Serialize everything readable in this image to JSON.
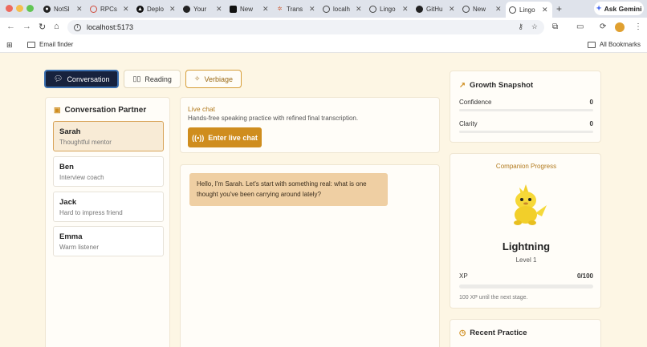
{
  "browser": {
    "tabs": [
      {
        "label": "NotSl",
        "icon": "github-icon"
      },
      {
        "label": "RPCs",
        "icon": "rpc-icon"
      },
      {
        "label": "Deplo",
        "icon": "vercel-icon"
      },
      {
        "label": "Your",
        "icon": "github-icon"
      },
      {
        "label": "New",
        "icon": "notion-icon"
      },
      {
        "label": "Trans",
        "icon": "transcription-icon"
      },
      {
        "label": "localh",
        "icon": "globe-icon"
      },
      {
        "label": "Lingo",
        "icon": "globe-icon"
      },
      {
        "label": "GitHu",
        "icon": "github-icon"
      },
      {
        "label": "New",
        "icon": "globe-icon"
      },
      {
        "label": "Lingo",
        "icon": "globe-icon",
        "active": true
      }
    ],
    "gemini_label": "Ask Gemini",
    "url": "localhost:5173",
    "bookmarks": {
      "item": "Email finder",
      "all": "All Bookmarks"
    }
  },
  "modes": {
    "conversation": "Conversation",
    "reading": "Reading",
    "verbiage": "Verbiage"
  },
  "partners": {
    "title": "Conversation Partner",
    "items": [
      {
        "name": "Sarah",
        "role": "Thoughtful mentor"
      },
      {
        "name": "Ben",
        "role": "Interview coach"
      },
      {
        "name": "Jack",
        "role": "Hard to impress friend"
      },
      {
        "name": "Emma",
        "role": "Warm listener"
      }
    ]
  },
  "live_chat": {
    "title": "Live chat",
    "description": "Hands-free speaking practice with refined final transcription.",
    "button": "Enter live chat"
  },
  "chat": {
    "messages": [
      {
        "text": "Hello, I'm Sarah. Let's start with something real: what is one thought you've been carrying around lately?"
      }
    ]
  },
  "growth": {
    "title": "Growth Snapshot",
    "metrics": [
      {
        "label": "Confidence",
        "value": "0"
      },
      {
        "label": "Clarity",
        "value": "0"
      }
    ]
  },
  "companion": {
    "title": "Companion Progress",
    "name": "Lightning",
    "level": "Level 1",
    "xp_label": "XP",
    "xp_value": "0/100",
    "xp_fraction": 0,
    "note": "100 XP until the next stage."
  },
  "recent": {
    "title": "Recent Practice"
  },
  "colors": {
    "accent": "#cf8d1e",
    "background": "#fdf6e4",
    "active_mode": "#17223d"
  }
}
